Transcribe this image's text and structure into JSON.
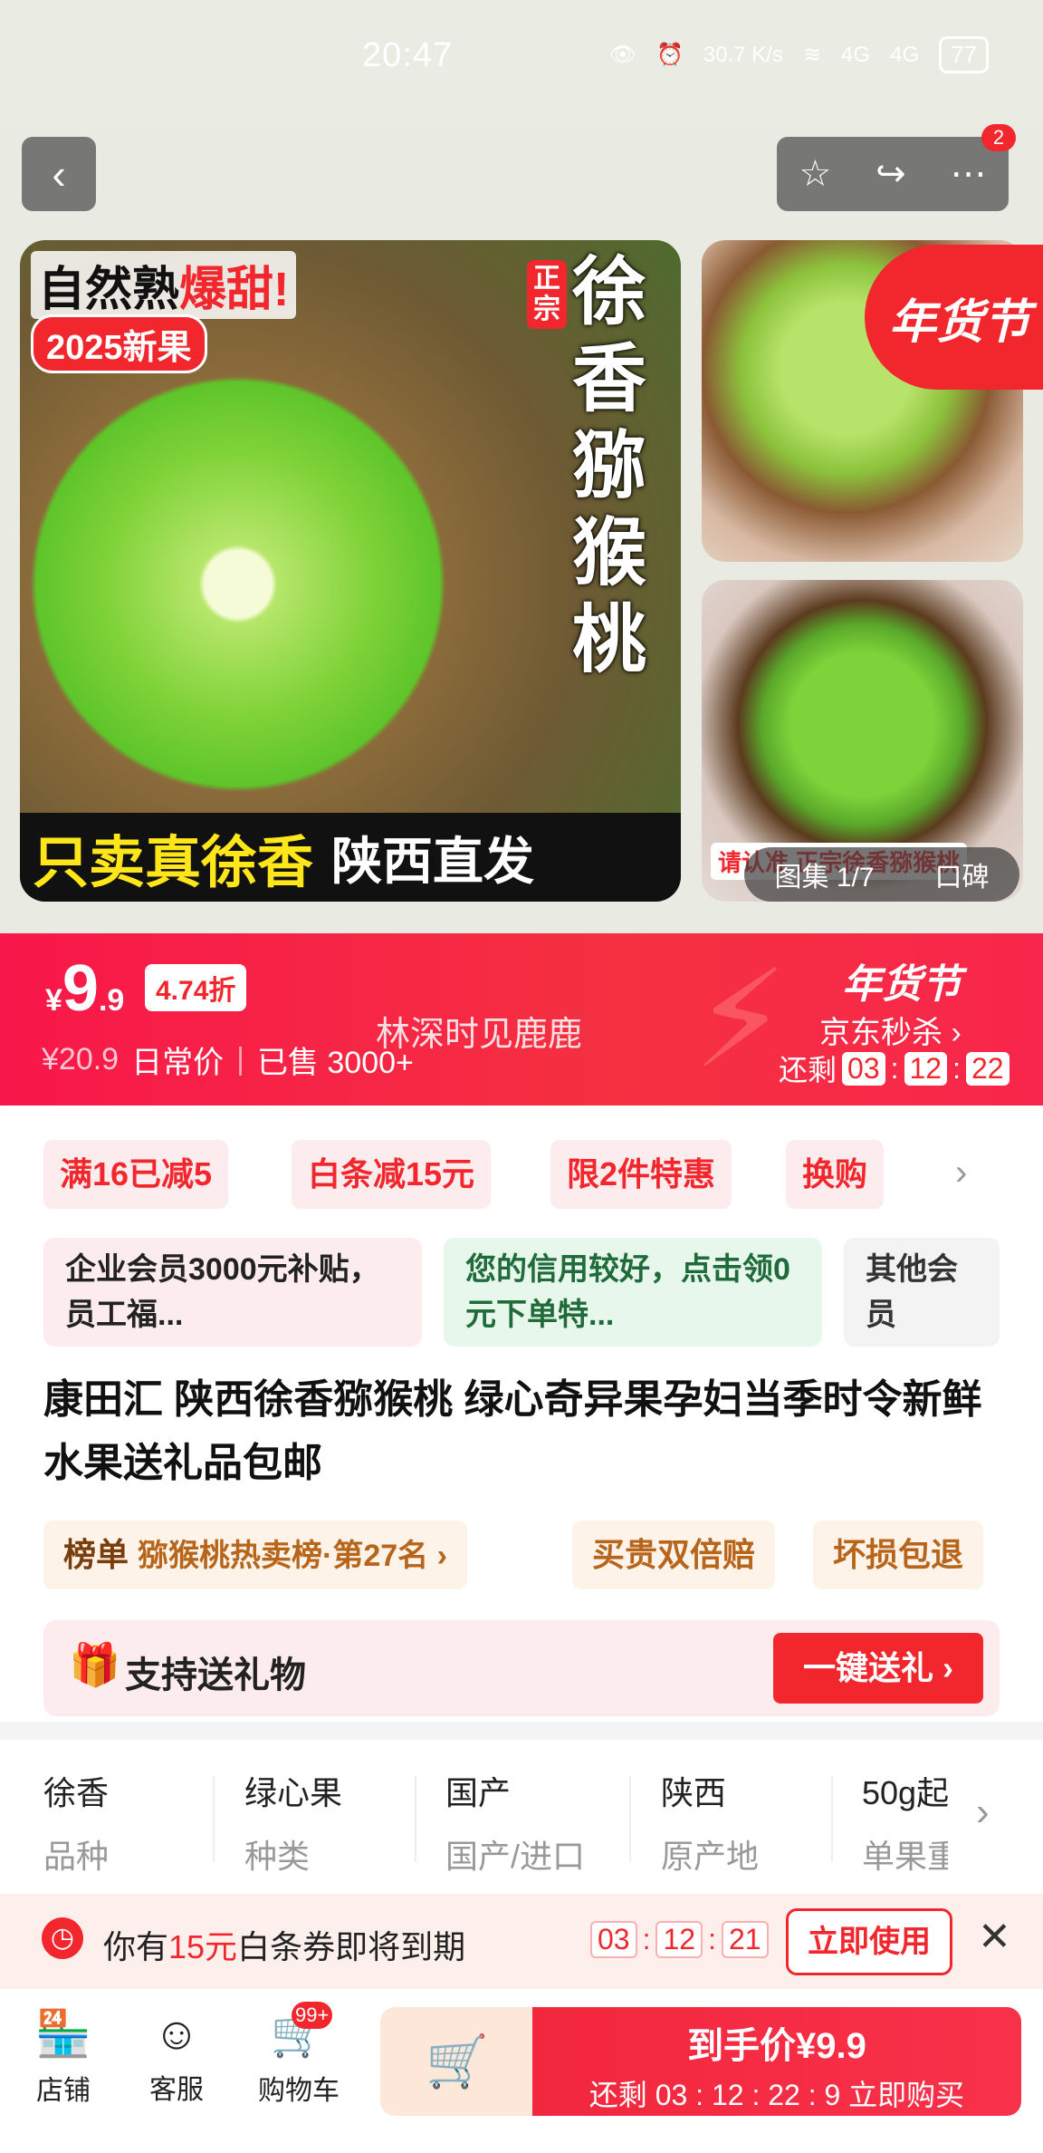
{
  "status_bar": {
    "time": "20:47",
    "net_speed": "30.7 K/s",
    "signal1": "4G",
    "signal2": "4G",
    "battery": "77"
  },
  "nav": {
    "cart_badge": "2"
  },
  "gallery": {
    "main_tag_1": "自然熟",
    "main_tag_1_hot": "爆甜!",
    "main_tag_2": "2025新果",
    "main_side_small": "正宗",
    "main_vertical": "徐香猕猴桃",
    "main_bottom_left": "只卖真徐香",
    "main_bottom_right": "陕西直发",
    "badge_newyear": "年货节",
    "thumb2_caption": "请认准 正宗徐香猕猴桃",
    "counter": "图集 1/7",
    "reviews": "口碑"
  },
  "price": {
    "currency": "¥",
    "integer": "9",
    "decimal": ".9",
    "discount": "4.74折",
    "daily_price": "¥20.9",
    "daily_label": "日常价",
    "sold": "已售 3000+",
    "watermark": "林深时见鹿鹿",
    "promo_logo": "年货节",
    "flash": "京东秒杀 ›",
    "remain_label": "还剩",
    "cd_h": "03",
    "cd_m": "12",
    "cd_s": "22"
  },
  "promos": [
    "满16已减5",
    "白条减15元",
    "限2件特惠",
    "换购"
  ],
  "members": {
    "enterprise": "企业会员3000元补贴，员工福...",
    "credit": "您的信用较好，点击领0元下单特...",
    "other": "其他会员"
  },
  "title": "康田汇 陕西徐香猕猴桃 绿心奇异果孕妇当季时令新鲜水果送礼品包邮",
  "rank": {
    "label": "榜单",
    "text": "猕猴桃热卖榜·第27名 ›",
    "guarantee1": "买贵双倍赔",
    "guarantee2": "坏损包退"
  },
  "gift": {
    "label": "支持送礼物",
    "button": "一键送礼 ›"
  },
  "specs": [
    {
      "value": "徐香",
      "key": "品种"
    },
    {
      "value": "绿心果",
      "key": "种类"
    },
    {
      "value": "国产",
      "key": "国产/进口"
    },
    {
      "value": "陕西",
      "key": "原产地"
    },
    {
      "value": "50g起",
      "key": "单果重"
    }
  ],
  "coupon": {
    "prefix": "你有",
    "amount": "15元",
    "suffix": "白条券即将到期",
    "cd_h": "03",
    "cd_m": "12",
    "cd_s": "21",
    "use": "立即使用"
  },
  "bottom": {
    "shop": "店铺",
    "service": "客服",
    "cart": "购物车",
    "cart_badge": "99+",
    "buy_price": "到手价¥9.9",
    "buy_sub": "还剩 03 : 12 : 22 : 9  立即购买"
  }
}
